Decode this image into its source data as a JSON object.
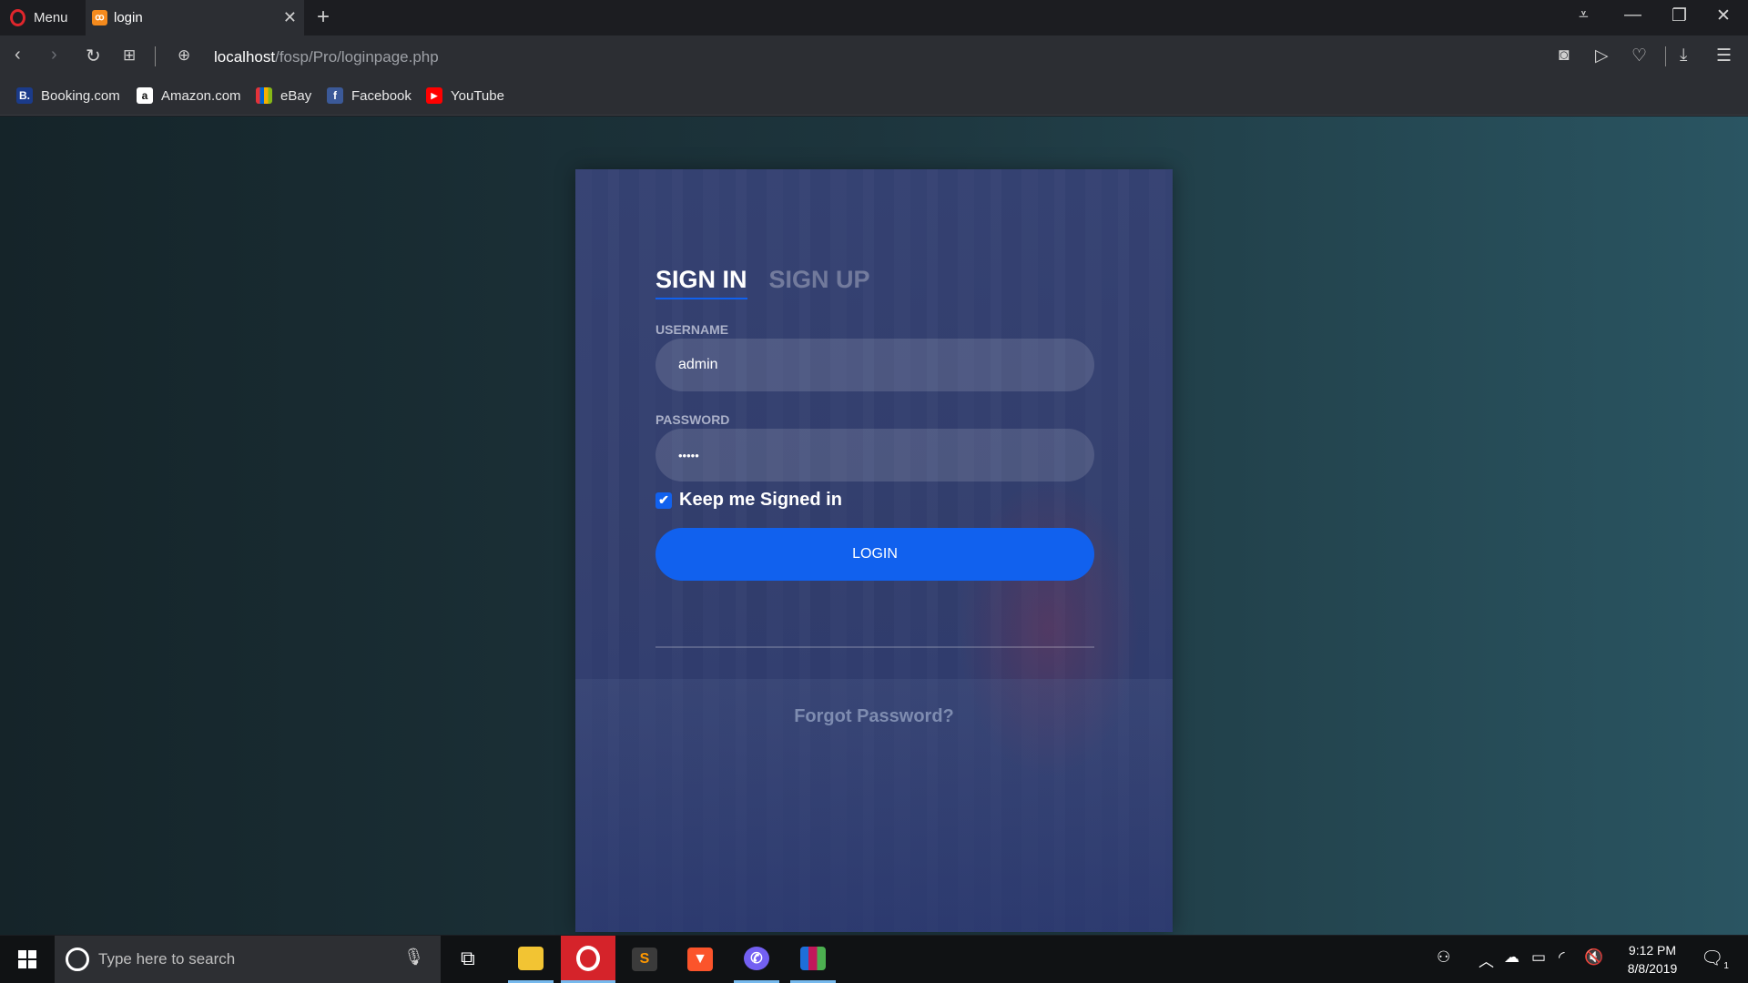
{
  "browser": {
    "menu_label": "Menu",
    "tab_title": "login",
    "tab_favicon": "XAMPP",
    "new_tab_icon": "+",
    "url_host": "localhost",
    "url_path": "/fosp/Pro/loginpage.php",
    "bookmarks": [
      {
        "label": "Booking.com",
        "icon": "B.",
        "color": "#1b3b8a"
      },
      {
        "label": "Amazon.com",
        "icon": "a",
        "color": "#ffffff"
      },
      {
        "label": "eBay",
        "icon": "",
        "color": "#e53238"
      },
      {
        "label": "Facebook",
        "icon": "f",
        "color": "#3b5998"
      },
      {
        "label": "YouTube",
        "icon": "▶",
        "color": "#ff0000"
      }
    ]
  },
  "login": {
    "tabs": {
      "signin": "SIGN IN",
      "signup": "SIGN UP"
    },
    "username_label": "USERNAME",
    "username_value": "admin",
    "password_label": "PASSWORD",
    "password_value": "•••••",
    "keep_signed_in": "Keep me Signed in",
    "keep_signed_in_checked": true,
    "login_button": "LOGIN",
    "forgot_password": "Forgot Password?",
    "accent": "#1161ee"
  },
  "taskbar": {
    "search_placeholder": "Type here to search",
    "time": "9:12 PM",
    "date": "8/8/2019",
    "notification_count": "1"
  }
}
